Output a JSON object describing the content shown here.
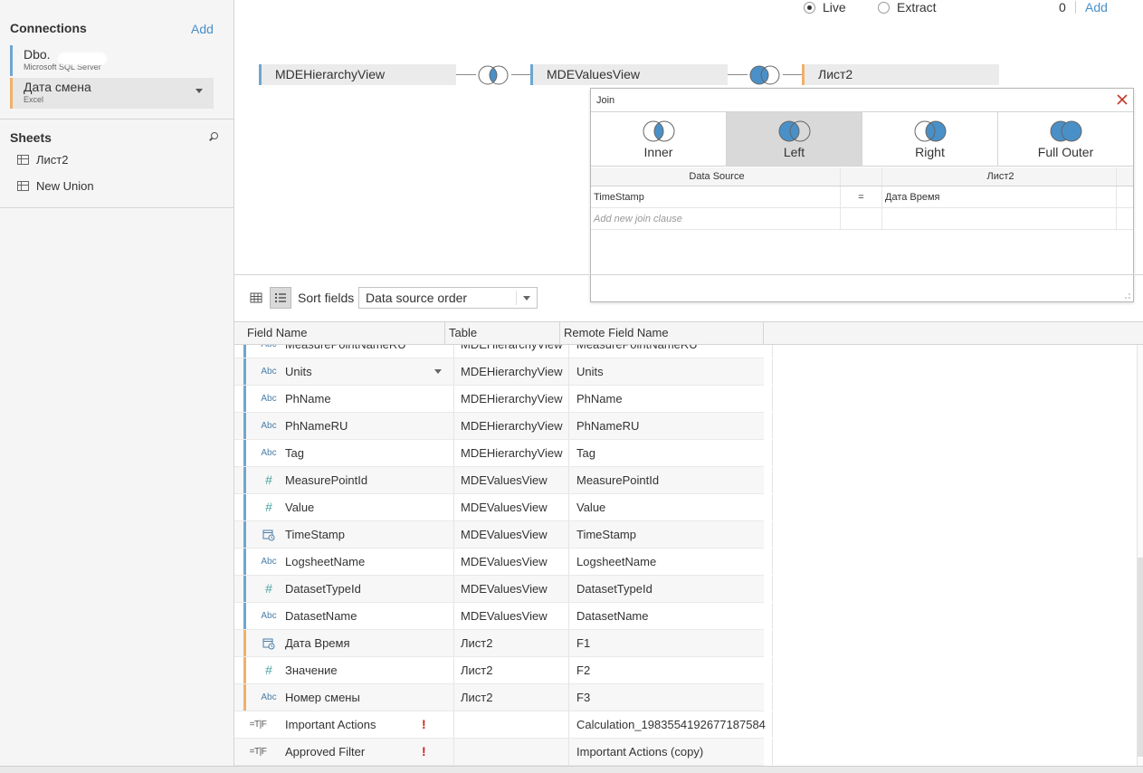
{
  "sidebar": {
    "connections_label": "Connections",
    "add_label": "Add",
    "connections": [
      {
        "name": "Dbo.",
        "sub": "Microsoft SQL Server"
      },
      {
        "name": "Дата смена",
        "sub": "Excel"
      }
    ],
    "sheets_label": "Sheets",
    "sheets": [
      {
        "label": "Лист2"
      },
      {
        "label": "New Union"
      }
    ]
  },
  "canvas": {
    "connection_mode": {
      "live": "Live",
      "extract": "Extract",
      "selected": "Live"
    },
    "filters": {
      "count": "0",
      "add": "Add"
    },
    "tables": [
      "MDEHierarchyView",
      "MDEValuesView",
      "Лист2"
    ]
  },
  "join_dialog": {
    "title": "Join",
    "types": [
      "Inner",
      "Left",
      "Right",
      "Full Outer"
    ],
    "selected": "Left",
    "headers": {
      "left": "Data Source",
      "right": "Лист2"
    },
    "clauses": [
      {
        "left": "TimeStamp",
        "op": "=",
        "right": "Дата Время"
      }
    ],
    "add_placeholder": "Add new join clause"
  },
  "toolbar": {
    "sort_label": "Sort fields",
    "sort_value": "Data source order"
  },
  "grid": {
    "columns": [
      "Field Name",
      "Table",
      "Remote Field Name"
    ],
    "rows": [
      {
        "type": "Abc",
        "name": "MeasurePointNameRU",
        "table": "MDEHierarchyView",
        "remote": "MeasurePointNameRU",
        "src": "blue"
      },
      {
        "type": "Abc",
        "name": "Units",
        "table": "MDEHierarchyView",
        "remote": "Units",
        "src": "blue"
      },
      {
        "type": "Abc",
        "name": "PhName",
        "table": "MDEHierarchyView",
        "remote": "PhName",
        "src": "blue"
      },
      {
        "type": "Abc",
        "name": "PhNameRU",
        "table": "MDEHierarchyView",
        "remote": "PhNameRU",
        "src": "blue"
      },
      {
        "type": "Abc",
        "name": "Tag",
        "table": "MDEHierarchyView",
        "remote": "Tag",
        "src": "blue"
      },
      {
        "type": "#",
        "name": "MeasurePointId",
        "table": "MDEValuesView",
        "remote": "MeasurePointId",
        "src": "blue"
      },
      {
        "type": "#",
        "name": "Value",
        "table": "MDEValuesView",
        "remote": "Value",
        "src": "blue"
      },
      {
        "type": "datetime",
        "name": "TimeStamp",
        "table": "MDEValuesView",
        "remote": "TimeStamp",
        "src": "blue"
      },
      {
        "type": "Abc",
        "name": "LogsheetName",
        "table": "MDEValuesView",
        "remote": "LogsheetName",
        "src": "blue"
      },
      {
        "type": "#",
        "name": "DatasetTypeId",
        "table": "MDEValuesView",
        "remote": "DatasetTypeId",
        "src": "blue"
      },
      {
        "type": "Abc",
        "name": "DatasetName",
        "table": "MDEValuesView",
        "remote": "DatasetName",
        "src": "blue"
      },
      {
        "type": "datetime",
        "name": "Дата Время",
        "table": "Лист2",
        "remote": "F1",
        "src": "orange"
      },
      {
        "type": "#",
        "name": "Значение",
        "table": "Лист2",
        "remote": "F2",
        "src": "orange"
      },
      {
        "type": "Abc",
        "name": "Номер смены",
        "table": "Лист2",
        "remote": "F3",
        "src": "orange"
      },
      {
        "type": "=T|F",
        "name": "Important Actions",
        "table": "",
        "remote": "Calculation_1983554192677187584",
        "src": "none",
        "warn": "!"
      },
      {
        "type": "=T|F",
        "name": "Approved Filter",
        "table": "",
        "remote": "Important Actions (copy)",
        "src": "none",
        "warn": "!"
      }
    ]
  },
  "colors": {
    "accent": "#4a90c8",
    "venn_fill": "#4a90c8",
    "sql_edge": "#6fa6cf",
    "excel_edge": "#f0b06a",
    "close": "#c0392b"
  }
}
